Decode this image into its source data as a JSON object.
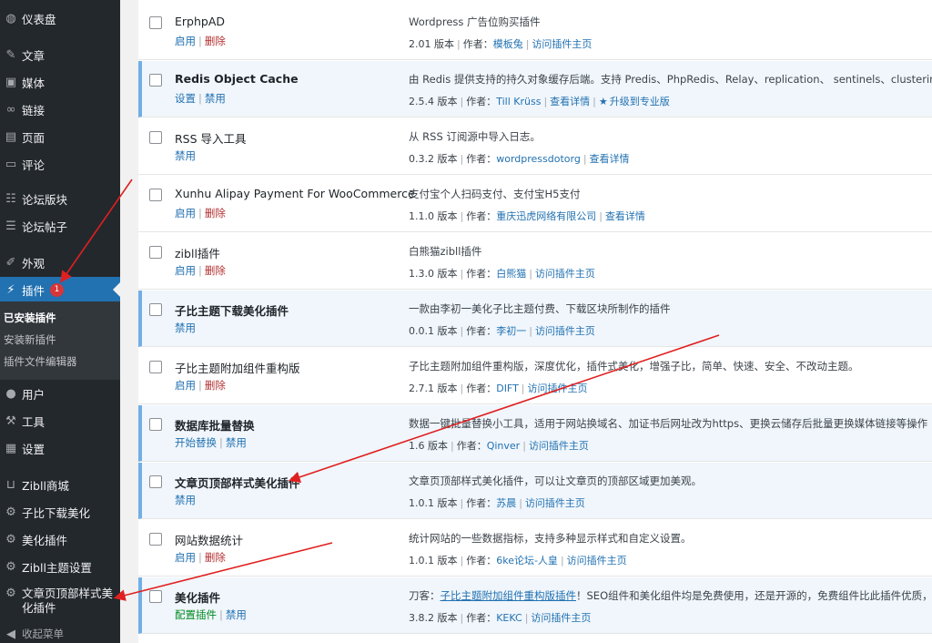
{
  "sidebar": {
    "items": [
      {
        "label": "仪表盘",
        "icon": "dashboard-icon"
      },
      {
        "label": "文章",
        "icon": "pin-icon"
      },
      {
        "label": "媒体",
        "icon": "media-icon"
      },
      {
        "label": "链接",
        "icon": "link-icon"
      },
      {
        "label": "页面",
        "icon": "page-icon"
      },
      {
        "label": "评论",
        "icon": "comment-icon"
      },
      {
        "label": "论坛版块",
        "icon": "forum-icon"
      },
      {
        "label": "论坛帖子",
        "icon": "forum-post-icon"
      },
      {
        "label": "外观",
        "icon": "brush-icon"
      },
      {
        "label": "插件",
        "icon": "plugin-icon",
        "badge": "1",
        "active": true
      },
      {
        "label": "用户",
        "icon": "user-icon"
      },
      {
        "label": "工具",
        "icon": "wrench-icon"
      },
      {
        "label": "设置",
        "icon": "settings-icon"
      },
      {
        "label": "Zibll商城",
        "icon": "cart-icon"
      },
      {
        "label": "子比下载美化",
        "icon": "gear-icon"
      },
      {
        "label": "美化插件",
        "icon": "gear-icon"
      },
      {
        "label": "Zibll主题设置",
        "icon": "gear-icon"
      },
      {
        "label": "文章页顶部样式美化插件",
        "icon": "gear-icon"
      }
    ],
    "submenu": [
      "已安装插件",
      "安装新插件",
      "插件文件编辑器"
    ],
    "collapse_label": "收起菜单"
  },
  "plugins": [
    {
      "name": "ErphpAD",
      "active": false,
      "actions": [
        {
          "label": "启用",
          "kind": "link"
        },
        {
          "label": "删除",
          "kind": "delete"
        }
      ],
      "description": "Wordpress 广告位购买插件",
      "version": "2.01 版本",
      "author_label": "作者：",
      "author": "模板兔",
      "links": [
        "访问插件主页"
      ]
    },
    {
      "name": "Redis Object Cache",
      "active": true,
      "actions": [
        {
          "label": "设置",
          "kind": "link"
        },
        {
          "label": "禁用",
          "kind": "link"
        }
      ],
      "description": "由 Redis 提供支持的持久对象缓存后端。支持 Predis、PhpRedis、Relay、replication、 sentinels、clustering和 WP-C",
      "version": "2.5.4 版本",
      "author_label": "作者：",
      "author": "Till Krüss",
      "links": [
        "查看详情",
        "升级到专业版"
      ]
    },
    {
      "name": "RSS 导入工具",
      "active": false,
      "actions": [
        {
          "label": "禁用",
          "kind": "link"
        }
      ],
      "description": "从 RSS 订阅源中导入日志。",
      "version": "0.3.2 版本",
      "author_label": "作者：",
      "author": "wordpressdotorg",
      "links": [
        "查看详情"
      ]
    },
    {
      "name": "Xunhu Alipay Payment For WooCommerce",
      "active": false,
      "actions": [
        {
          "label": "启用",
          "kind": "link"
        },
        {
          "label": "删除",
          "kind": "delete"
        }
      ],
      "description": "支付宝个人扫码支付、支付宝H5支付",
      "version": "1.1.0 版本",
      "author_label": "作者：",
      "author": "重庆迅虎网络有限公司",
      "links": [
        "查看详情"
      ]
    },
    {
      "name": "zibll插件",
      "active": false,
      "actions": [
        {
          "label": "启用",
          "kind": "link"
        },
        {
          "label": "删除",
          "kind": "delete"
        }
      ],
      "description": "白熊猫zibll插件",
      "version": "1.3.0 版本",
      "author_label": "作者：",
      "author": "白熊猫",
      "links": [
        "访问插件主页"
      ]
    },
    {
      "name": "子比主题下载美化插件",
      "active": true,
      "actions": [
        {
          "label": "禁用",
          "kind": "link"
        }
      ],
      "description": "一款由李初一美化子比主题付费、下载区块所制作的插件",
      "version": "0.0.1 版本",
      "author_label": "作者：",
      "author": "李初一",
      "links": [
        "访问插件主页"
      ]
    },
    {
      "name": "子比主题附加组件重构版",
      "active": false,
      "actions": [
        {
          "label": "启用",
          "kind": "link"
        },
        {
          "label": "删除",
          "kind": "delete"
        }
      ],
      "description": "子比主题附加组件重构版，深度优化，插件式美化，增强子比，简单、快速、安全、不改动主题。",
      "version": "2.7.1 版本",
      "author_label": "作者：",
      "author": "DIFT",
      "links": [
        "访问插件主页"
      ]
    },
    {
      "name": "数据库批量替换",
      "active": true,
      "actions": [
        {
          "label": "开始替换",
          "kind": "link"
        },
        {
          "label": "禁用",
          "kind": "link"
        }
      ],
      "description": "数据一键批量替换小工具，适用于网站换域名、加证书后网址改为https、更换云储存后批量更换媒体链接等操作",
      "version": "1.6 版本",
      "author_label": "作者：",
      "author": "Qinver",
      "links": [
        "访问插件主页"
      ]
    },
    {
      "name": "文章页顶部样式美化插件",
      "active": true,
      "actions": [
        {
          "label": "禁用",
          "kind": "link"
        }
      ],
      "description": "文章页顶部样式美化插件，可以让文章页的顶部区域更加美观。",
      "version": "1.0.1 版本",
      "author_label": "作者：",
      "author": "苏晨",
      "links": [
        "访问插件主页"
      ]
    },
    {
      "name": "网站数据统计",
      "active": false,
      "actions": [
        {
          "label": "启用",
          "kind": "link"
        },
        {
          "label": "删除",
          "kind": "delete"
        }
      ],
      "description": "统计网站的一些数据指标，支持多种显示样式和自定义设置。",
      "version": "1.0.1 版本",
      "author_label": "作者：",
      "author": "6ke论坛-人皇",
      "links": [
        "访问插件主页"
      ]
    },
    {
      "name": "美化插件",
      "active": true,
      "actions": [
        {
          "label": "配置插件",
          "kind": "green"
        },
        {
          "label": "禁用",
          "kind": "link"
        }
      ],
      "description_prefix": "刀客：",
      "description_link": "子比主题附加组件重构版插件",
      "description_suffix": "！SEO组件和美化组件均是免费使用，还是开源的，免费组件比此插件优质，另一",
      "version": "3.8.2 版本",
      "author_label": "作者：",
      "author": "KEKC",
      "links": [
        "访问插件主页"
      ]
    }
  ],
  "colors": {
    "sidebar_bg": "#23282d",
    "active_menu": "#2271b1",
    "annotation": "#e02020",
    "link": "#2271b1",
    "delete": "#b32d2e"
  }
}
